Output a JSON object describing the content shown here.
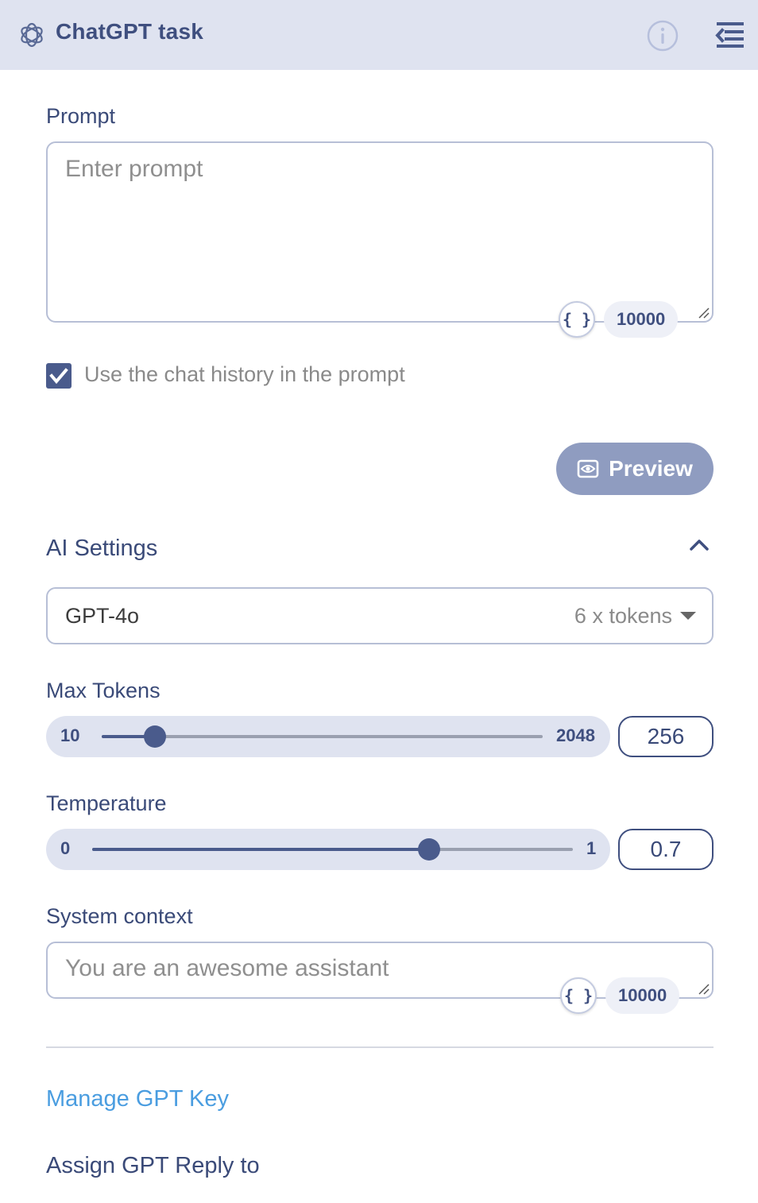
{
  "header": {
    "title": "ChatGPT task",
    "logo_icon": "openai-logo-icon",
    "info_icon": "info-icon",
    "collapse_icon": "collapse-panel-icon"
  },
  "prompt": {
    "label": "Prompt",
    "placeholder": "Enter prompt",
    "value": "",
    "variable_button": "{ }",
    "char_limit": "10000"
  },
  "chat_history": {
    "label": "Use the chat history in the prompt",
    "checked": true
  },
  "preview_button": {
    "label": "Preview",
    "icon": "eye-icon"
  },
  "ai_settings": {
    "title": "AI Settings",
    "expanded": true,
    "model": {
      "value": "GPT-4o",
      "cost": "6 x tokens"
    },
    "max_tokens": {
      "label": "Max Tokens",
      "min": "10",
      "max": "2048",
      "value": "256",
      "min_num": 10,
      "max_num": 2048,
      "value_num": 256
    },
    "temperature": {
      "label": "Temperature",
      "min": "0",
      "max": "1",
      "value": "0.7",
      "min_num": 0,
      "max_num": 1,
      "value_num": 0.7
    },
    "system_context": {
      "label": "System context",
      "placeholder": "You are an awesome assistant",
      "variable_button": "{ }",
      "char_limit": "10000"
    }
  },
  "manage_key_link": "Manage GPT Key",
  "assign_reply_label": "Assign GPT Reply to",
  "colors": {
    "header_bg": "#dfe3f0",
    "accent": "#4a5b8c",
    "link": "#4a9de0",
    "preview_bg": "#8f9cc0"
  }
}
